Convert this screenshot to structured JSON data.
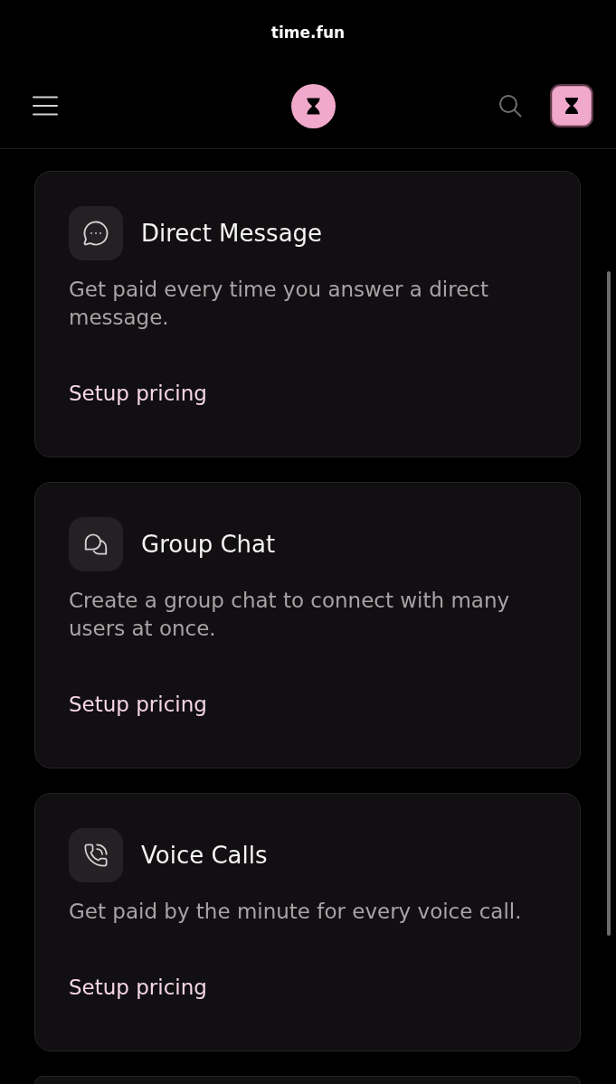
{
  "browser_bar": {
    "url": "time.fun"
  },
  "cards": [
    {
      "kind": "message",
      "title": "Direct Message",
      "description": "Get paid every time you answer a direct message.",
      "action": "Setup pricing"
    },
    {
      "kind": "group",
      "title": "Group Chat",
      "description": "Create a group chat to connect with many users at once.",
      "action": "Setup pricing"
    },
    {
      "kind": "call",
      "title": "Voice Calls",
      "description": "Get paid by the minute for every voice call.",
      "action": "Setup pricing"
    }
  ]
}
